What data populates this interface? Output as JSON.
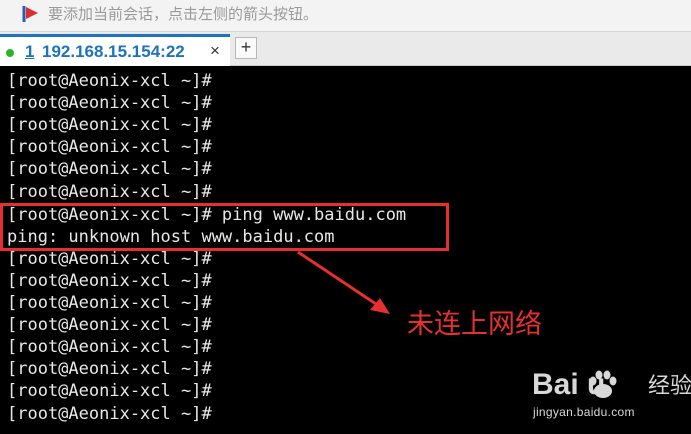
{
  "hint_bar": {
    "icon": "red-flag-arrow-icon",
    "text": "要添加当前会话，点击左侧的箭头按钮。"
  },
  "tab": {
    "number": "1",
    "host": "192.168.15.154:22",
    "status_icon": "connected-green-dot-icon",
    "close_label": "×",
    "add_label": "+"
  },
  "terminal": {
    "lines": [
      "[root@Aeonix-xcl ~]#",
      "[root@Aeonix-xcl ~]#",
      "[root@Aeonix-xcl ~]#",
      "[root@Aeonix-xcl ~]#",
      "[root@Aeonix-xcl ~]#",
      "[root@Aeonix-xcl ~]#",
      "[root@Aeonix-xcl ~]# ping www.baidu.com",
      "ping: unknown host www.baidu.com",
      "[root@Aeonix-xcl ~]#",
      "[root@Aeonix-xcl ~]#",
      "[root@Aeonix-xcl ~]#",
      "[root@Aeonix-xcl ~]#",
      "[root@Aeonix-xcl ~]#",
      "[root@Aeonix-xcl ~]#",
      "[root@Aeonix-xcl ~]#",
      "[root@Aeonix-xcl ~]#"
    ]
  },
  "annotation": {
    "text": "未连上网络",
    "color": "#e53030"
  },
  "watermark": {
    "brand": "Bai  u",
    "experience": "经验",
    "url": "jingyan.baidu.com"
  },
  "colors": {
    "accent": "#1e73be",
    "status_green": "#28b628",
    "highlight_red": "#e53030",
    "terminal_bg": "#000000",
    "terminal_fg": "#e8e8e8"
  }
}
